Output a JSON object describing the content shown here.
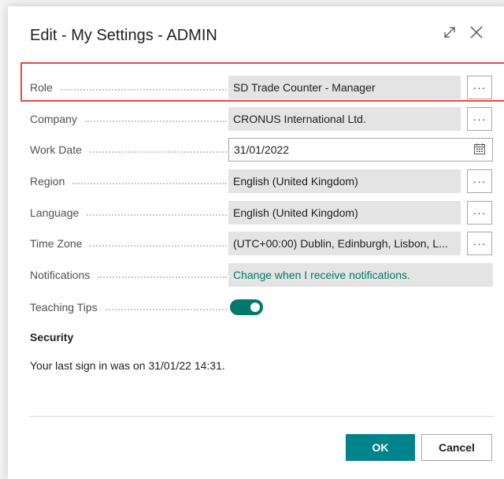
{
  "dialog": {
    "title": "Edit - My Settings - ADMIN",
    "expand_icon": "expand-icon",
    "close_icon": "close-icon"
  },
  "fields": {
    "role": {
      "label": "Role",
      "value": "SD Trade Counter - Manager",
      "lookup": "···"
    },
    "company": {
      "label": "Company",
      "value": "CRONUS International Ltd.",
      "lookup": "···"
    },
    "work_date": {
      "label": "Work Date",
      "value": "31/01/2022",
      "icon": "calendar-icon"
    },
    "region": {
      "label": "Region",
      "value": "English (United Kingdom)",
      "lookup": "···"
    },
    "language": {
      "label": "Language",
      "value": "English (United Kingdom)",
      "lookup": "···"
    },
    "time_zone": {
      "label": "Time Zone",
      "value": "(UTC+00:00) Dublin, Edinburgh, Lisbon, L...",
      "lookup": "···"
    },
    "notifications": {
      "label": "Notifications",
      "value": "Change when I receive notifications."
    },
    "teaching_tips": {
      "label": "Teaching Tips",
      "enabled": true
    }
  },
  "security": {
    "title": "Security",
    "last_sign_in": "Your last sign in was on 31/01/22 14:31."
  },
  "buttons": {
    "ok": "OK",
    "cancel": "Cancel"
  },
  "colors": {
    "accent": "#00838a",
    "link": "#00796b",
    "highlight": "#e24a4a"
  }
}
